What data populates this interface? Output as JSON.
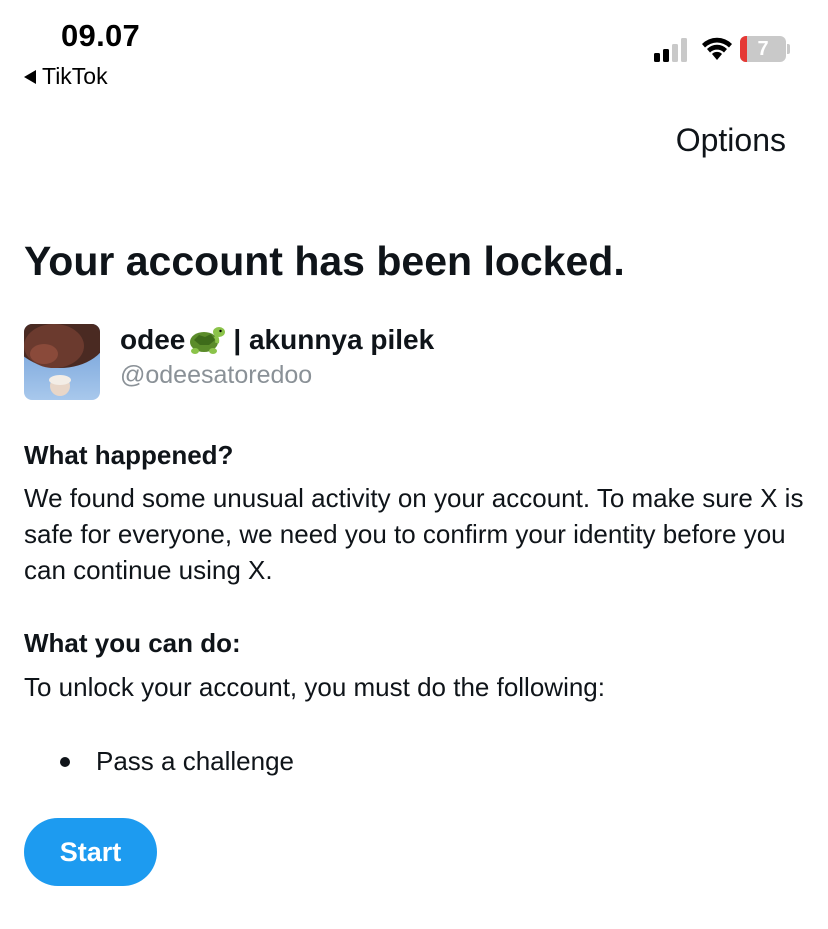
{
  "status_bar": {
    "time": "09.07",
    "back_label": "TikTok",
    "battery_level": "7",
    "battery_fraction": 0.07,
    "battery_color": "#e53935",
    "icons": [
      "signal-icon",
      "wifi-icon",
      "battery-icon"
    ]
  },
  "header": {
    "options_label": "Options"
  },
  "main": {
    "title": "Your account has been locked.",
    "account": {
      "name_prefix": "odee",
      "name_emoji": "turtle-emoji",
      "name_suffix": "| akunnya pilek",
      "handle": "@odeesatoredoo"
    },
    "what_happened": {
      "heading": "What happened?",
      "body": "We found some unusual activity on your account. To make sure X is safe for everyone, we need you to confirm your identity before you can continue using X."
    },
    "what_you_can_do": {
      "heading": "What you can do:",
      "body": "To unlock your account, you must do the following:",
      "steps": [
        "Pass a challenge"
      ]
    },
    "start_label": "Start"
  },
  "colors": {
    "accent": "#1d9bf0",
    "text": "#0f1419",
    "secondary_text": "#8a9197"
  }
}
